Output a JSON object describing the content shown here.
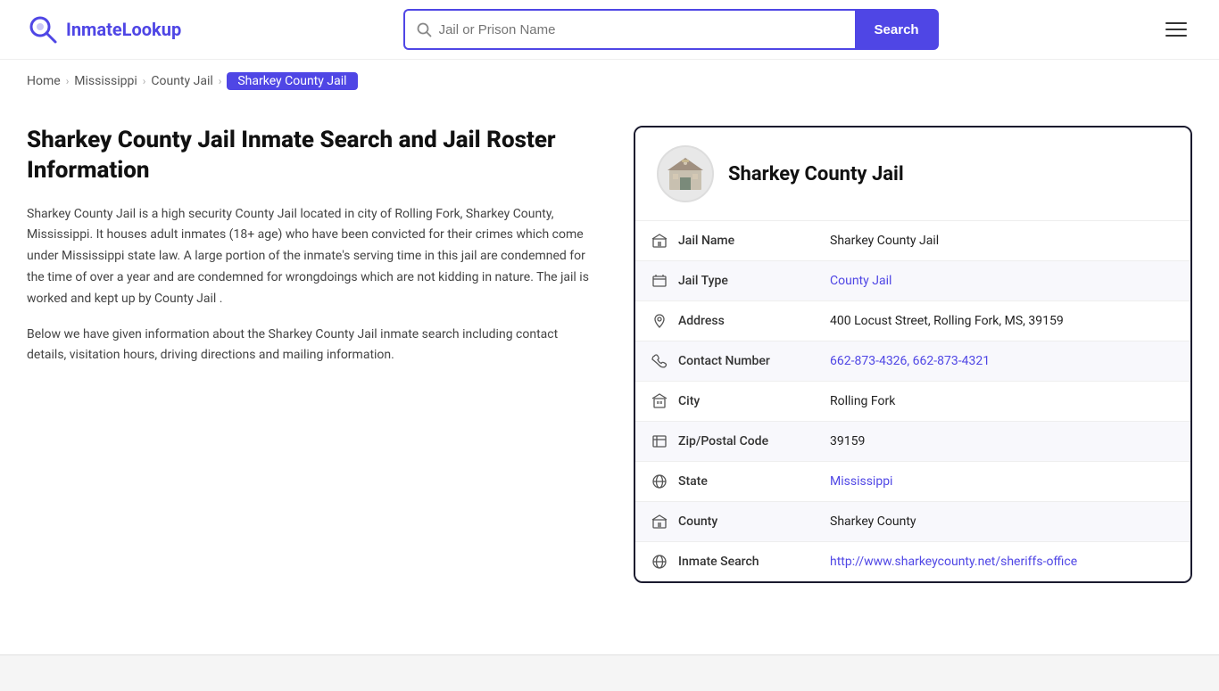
{
  "header": {
    "logo_text_part1": "Inmate",
    "logo_text_part2": "Lookup",
    "search_placeholder": "Jail or Prison Name",
    "search_button_label": "Search",
    "hamburger_label": "Menu"
  },
  "breadcrumb": {
    "home": "Home",
    "state": "Mississippi",
    "type": "County Jail",
    "current": "Sharkey County Jail"
  },
  "left": {
    "title": "Sharkey County Jail Inmate Search and Jail Roster Information",
    "description": "Sharkey County Jail is a high security County Jail located in city of Rolling Fork, Sharkey County, Mississippi. It houses adult inmates (18+ age) who have been convicted for their crimes which come under Mississippi state law. A large portion of the inmate's serving time in this jail are condemned for the time of over a year and are condemned for wrongdoings which are not kidding in nature. The jail is worked and kept up by County Jail .",
    "description2": "Below we have given information about the Sharkey County Jail inmate search including contact details, visitation hours, driving directions and mailing information."
  },
  "card": {
    "jail_name_header": "Sharkey County Jail",
    "rows": [
      {
        "icon": "jail-icon",
        "label": "Jail Name",
        "value": "Sharkey County Jail",
        "link": null
      },
      {
        "icon": "type-icon",
        "label": "Jail Type",
        "value": "County Jail",
        "link": "#"
      },
      {
        "icon": "address-icon",
        "label": "Address",
        "value": "400 Locust Street, Rolling Fork, MS, 39159",
        "link": null
      },
      {
        "icon": "phone-icon",
        "label": "Contact Number",
        "value": "662-873-4326, 662-873-4321",
        "link": "tel:6628734326"
      },
      {
        "icon": "city-icon",
        "label": "City",
        "value": "Rolling Fork",
        "link": null
      },
      {
        "icon": "zip-icon",
        "label": "Zip/Postal Code",
        "value": "39159",
        "link": null
      },
      {
        "icon": "state-icon",
        "label": "State",
        "value": "Mississippi",
        "link": "#"
      },
      {
        "icon": "county-icon",
        "label": "County",
        "value": "Sharkey County",
        "link": null
      },
      {
        "icon": "inmate-icon",
        "label": "Inmate Search",
        "value": "http://www.sharkeycounty.net/sheriffs-office",
        "link": "http://www.sharkeycounty.net/sheriffs-office"
      }
    ]
  }
}
